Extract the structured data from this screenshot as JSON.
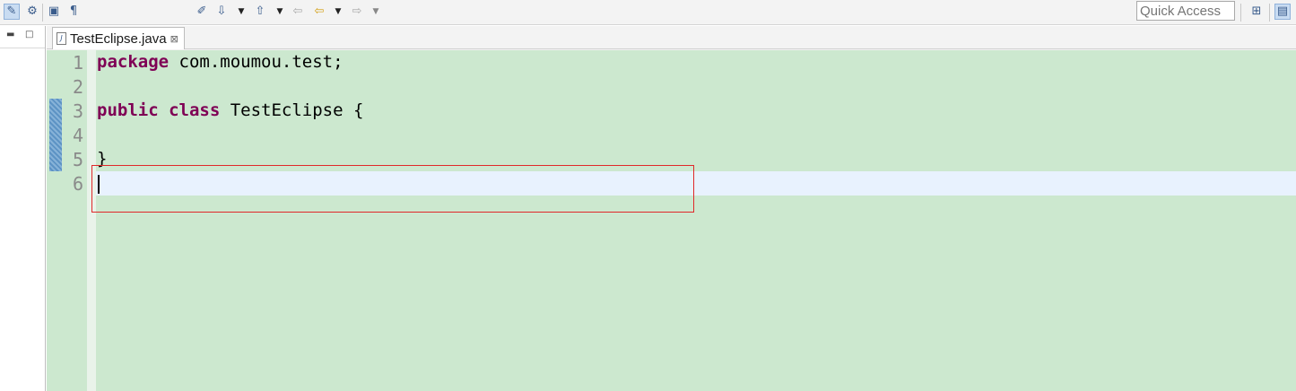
{
  "toolbar": {
    "icons": [
      "toggle-mark-occurrences-icon",
      "toggle-block-selection-icon",
      "show-whitespace-icon",
      "show-formatting-marks-icon",
      "next-annotation-icon",
      "previous-annotation-icon",
      "last-edit-location-icon",
      "back-icon",
      "forward-icon"
    ],
    "quick_access_placeholder": "Quick Access"
  },
  "editor": {
    "tab_label": "TestEclipse.java",
    "file_icon_glyph": "J",
    "close_glyph": "⊠",
    "line_numbers": [
      "1",
      "2",
      "3",
      "4",
      "5",
      "6"
    ],
    "lines": [
      {
        "kw": "package",
        "rest": " com.moumou.test;"
      },
      {
        "kw": "",
        "rest": ""
      },
      {
        "kw": "public class",
        "rest": " TestEclipse {"
      },
      {
        "kw": "",
        "rest": ""
      },
      {
        "kw": "",
        "rest": "}"
      },
      {
        "kw": "",
        "rest": ""
      }
    ],
    "current_line": 6
  },
  "colors": {
    "editor_background": "#cce8cf",
    "keyword": "#7f0055",
    "current_line": "#e8f2fe",
    "annotation": "#e0282a"
  }
}
